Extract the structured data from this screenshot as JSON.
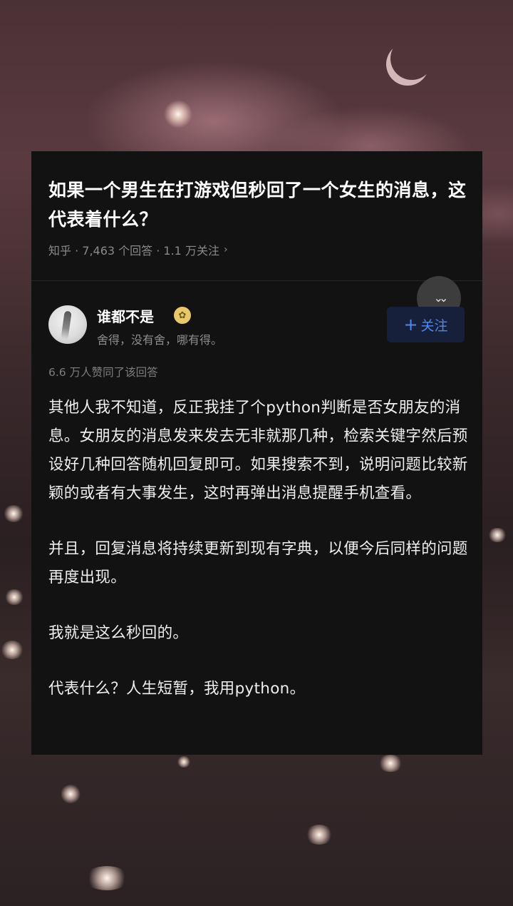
{
  "question": {
    "title": "如果一个男生在打游戏但秒回了一个女生的消息，这代表着什么？",
    "meta": "知乎 · 7,463 个回答 · 1.1 万关注",
    "meta_chevron": "›"
  },
  "collapse_icon": "⌄⌄",
  "author": {
    "name": "谁都不是",
    "bio": "舍得，没有舍，哪有得。",
    "badge_icon": "medal-badge"
  },
  "follow_button": {
    "plus": "+",
    "label": "关注"
  },
  "votes_text": "6.6 万人赞同了该回答",
  "answer": {
    "paragraphs": [
      "其他人我不知道，反正我挂了个python判断是否女朋友的消息。女朋友的消息发来发去无非就那几种，检索关键字然后预设好几种回答随机回复即可。如果搜索不到，说明问题比较新颖的或者有大事发生，这时再弹出消息提醒手机查看。",
      "并且，回复消息将持续更新到现有字典，以便今后同样的问题再度出现。",
      "我就是这么秒回的。",
      "代表什么？人生短暂，我用python。"
    ]
  }
}
